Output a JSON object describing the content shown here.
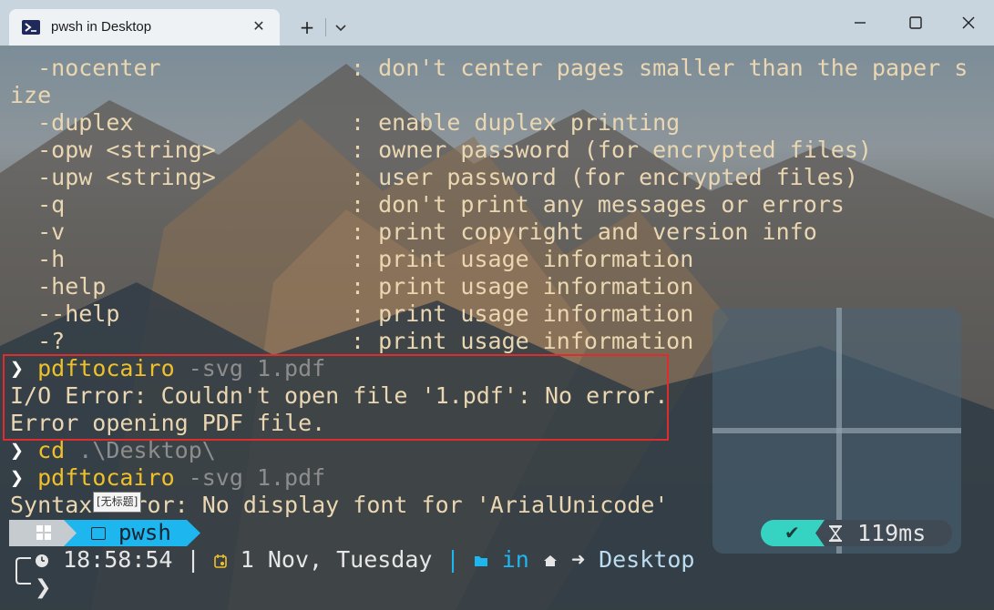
{
  "window": {
    "tab_title": "pwsh in Desktop",
    "tab_close_glyph": "✕",
    "new_tab_glyph": "+",
    "dropdown_glyph": "⌄"
  },
  "terminal": {
    "lines": [
      {
        "opt": "  -nocenter",
        "desc": ": don't center pages smaller than the paper s"
      },
      {
        "opt": "ize",
        "desc": ""
      },
      {
        "opt": "  -duplex",
        "desc": ": enable duplex printing"
      },
      {
        "opt": "  -opw <string>",
        "desc": ": owner password (for encrypted files)"
      },
      {
        "opt": "  -upw <string>",
        "desc": ": user password (for encrypted files)"
      },
      {
        "opt": "  -q",
        "desc": ": don't print any messages or errors"
      },
      {
        "opt": "  -v",
        "desc": ": print copyright and version info"
      },
      {
        "opt": "  -h",
        "desc": ": print usage information"
      },
      {
        "opt": "  -help",
        "desc": ": print usage information"
      },
      {
        "opt": "  --help",
        "desc": ": print usage information"
      },
      {
        "opt": "  -?",
        "desc": ": print usage information"
      }
    ],
    "prompt_glyph": "❯",
    "cmd1_name": "pdftocairo",
    "cmd1_args": " -svg 1.pdf",
    "err1": "I/O Error: Couldn't open file '1.pdf': No error.",
    "err2": "Error opening PDF file.",
    "cmd2_name": "cd",
    "cmd2_args": " .\\Desktop\\",
    "cmd3_name": "pdftocairo",
    "cmd3_args": " -svg 1.pdf",
    "err3": "Syntax Error: No display font for 'ArialUnicode'",
    "tooltip": "[无标题]"
  },
  "prompt": {
    "shell": "pwsh",
    "check_glyph": "✔",
    "duration": "119ms",
    "time": "18:58:54",
    "date": "1 Nov, Tuesday",
    "separator": "|",
    "in_word": "in",
    "dir": "Desktop",
    "arrow_glyph": "➜",
    "final_glyph": "❯"
  },
  "colors": {
    "text": "#ead7b2",
    "command": "#f0c02a",
    "args": "#8d8d8d",
    "accent": "#1eb6ef",
    "success": "#36d3c3",
    "highlight_border": "#e02c2c"
  }
}
